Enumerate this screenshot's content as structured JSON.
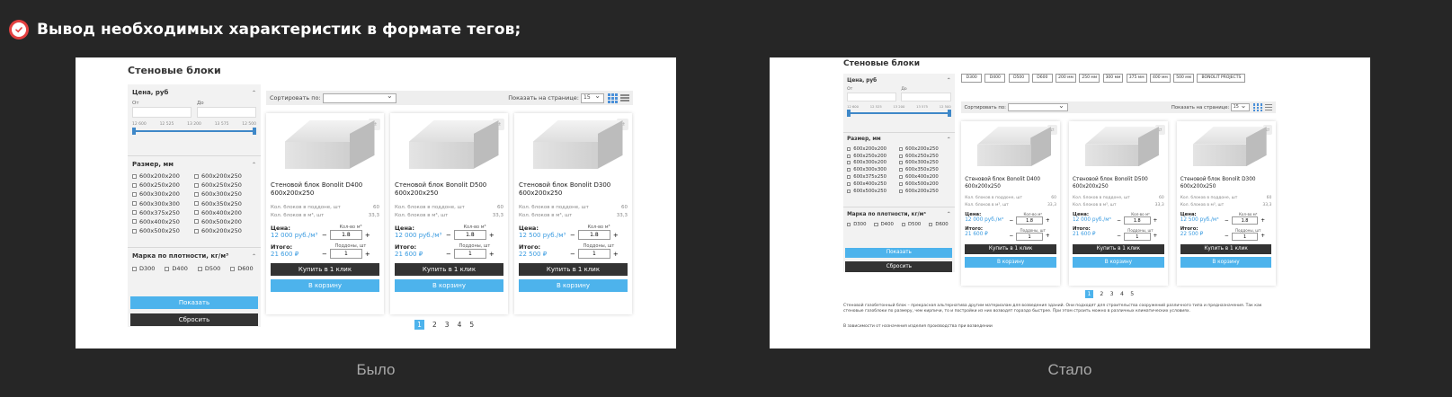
{
  "header": {
    "title": "Вывод необходимых характеристик в формате тегов;",
    "icon": "check-circle-icon",
    "accent": "#e34040"
  },
  "captions": {
    "before": "Было",
    "after": "Стало"
  },
  "shop": {
    "page_title": "Стеновые блоки",
    "filter": {
      "price_title": "Цена, руб",
      "from_label": "От",
      "to_label": "До",
      "range_ticks": [
        "12 600",
        "12 525",
        "13 200",
        "13 575",
        "12 500"
      ],
      "size_title": "Размер, мм",
      "sizes": [
        "600x200x200",
        "600x200x250",
        "600x250x200",
        "600x250x250",
        "600x300x200",
        "600x300x250",
        "600x300x300",
        "600x350x250",
        "600x375x250",
        "600x400x200",
        "600x400x250",
        "600x500x200",
        "600x500x250",
        "600x200x250"
      ],
      "density_title": "Марка по плотности, кг/м³",
      "densities": [
        "D300",
        "D400",
        "D500",
        "D600"
      ],
      "show_button": "Показать",
      "reset_button": "Сбросить"
    },
    "sort_label": "Сортировать по:",
    "per_page_label": "Показать на странице:",
    "per_page_value": "15",
    "products": [
      {
        "name": "Стеновой блок Bonolit D400 600x200x250",
        "qty_pallet_label": "Кол. блоков в поддоне, шт",
        "qty_pallet": "60",
        "qty_m3_label": "Кол. блоков в м³, шт",
        "qty_m3": "33,3",
        "price_label": "Цена:",
        "price": "12 000 руб./м³",
        "volume_label": "Кол-во м³",
        "volume": "1.8",
        "total_label": "Итого:",
        "total": "21 600 ₽",
        "pallets_label": "Поддоны, шт",
        "pallets": "1"
      },
      {
        "name": "Стеновой блок Bonolit D500 600x200x250",
        "qty_pallet_label": "Кол. блоков в поддоне, шт",
        "qty_pallet": "60",
        "qty_m3_label": "Кол. блоков в м³, шт",
        "qty_m3": "33,3",
        "price_label": "Цена:",
        "price": "12 000 руб./м³",
        "volume_label": "Кол-во м³",
        "volume": "1.8",
        "total_label": "Итого:",
        "total": "21 600 ₽",
        "pallets_label": "Поддоны, шт",
        "pallets": "1"
      },
      {
        "name": "Стеновой блок Bonolit D300 600x200x250",
        "qty_pallet_label": "Кол. блоков в поддоне, шт",
        "qty_pallet": "60",
        "qty_m3_label": "Кол. блоков в м³, шт",
        "qty_m3": "33,3",
        "price_label": "Цена:",
        "price": "12 500 руб./м³",
        "volume_label": "Кол-во м³",
        "volume": "1.8",
        "total_label": "Итого:",
        "total": "22 500 ₽",
        "pallets_label": "Поддоны, шт",
        "pallets": "1"
      }
    ],
    "buy_one_click": "Купить в 1 клик",
    "add_to_cart": "В корзину",
    "pages": [
      "1",
      "2",
      "3",
      "4",
      "5"
    ],
    "active_page": "1",
    "tags": [
      "D300",
      "D400",
      "D500",
      "D600",
      "200 мм",
      "250 мм",
      "300 мм",
      "375 мм",
      "400 мм",
      "500 мм",
      "BONOLIT PROJECTS"
    ],
    "description": "Стеновой газобетонный блок – прекрасная альтернатива другим материалам для возведения зданий. Они подходят для строительства сооружений различного типа и предназначения. Так как стеновые газоблоки по размеру, чем кирпичи, то и постройки из них возводят гораздо быстрее. При этом строить можно в различных климатических условиях.",
    "description2": "В зависимости от назначения изделия производства при возведении"
  },
  "colors": {
    "blue": "#4db3ec",
    "dark": "#333333",
    "price": "#3a9be0",
    "bg": "#262626"
  }
}
